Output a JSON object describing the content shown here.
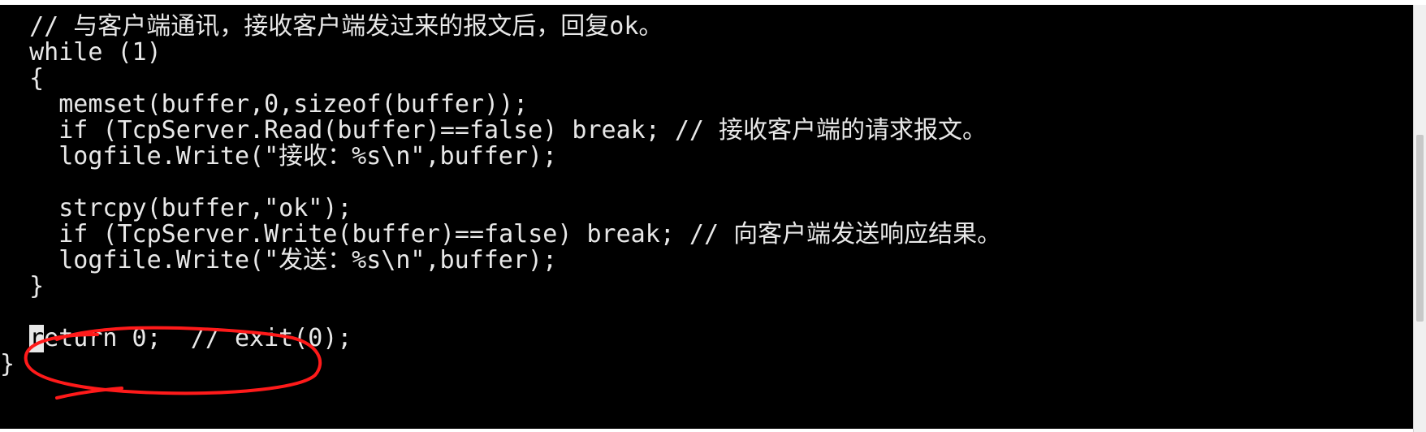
{
  "editor": {
    "lines": [
      "  // 与客户端通讯，接收客户端发过来的报文后，回复ok。",
      "  while (1)",
      "  {",
      "    memset(buffer,0,sizeof(buffer));",
      "    if (TcpServer.Read(buffer)==false) break; // 接收客户端的请求报文。",
      "    logfile.Write(\"接收：%s\\n\",buffer);",
      "",
      "    strcpy(buffer,\"ok\");",
      "    if (TcpServer.Write(buffer)==false) break; // 向客户端发送响应结果。",
      "    logfile.Write(\"发送：%s\\n\",buffer);",
      "  }",
      "",
      "  return 0;  // exit(0);",
      "}"
    ],
    "cursor_line": {
      "indent": "  ",
      "cursor_char": "r",
      "rest": "eturn 0;  // exit(0);"
    }
  },
  "colors": {
    "background": "#000000",
    "text": "#e8e8e8",
    "annotation": "#ff1a1a"
  }
}
